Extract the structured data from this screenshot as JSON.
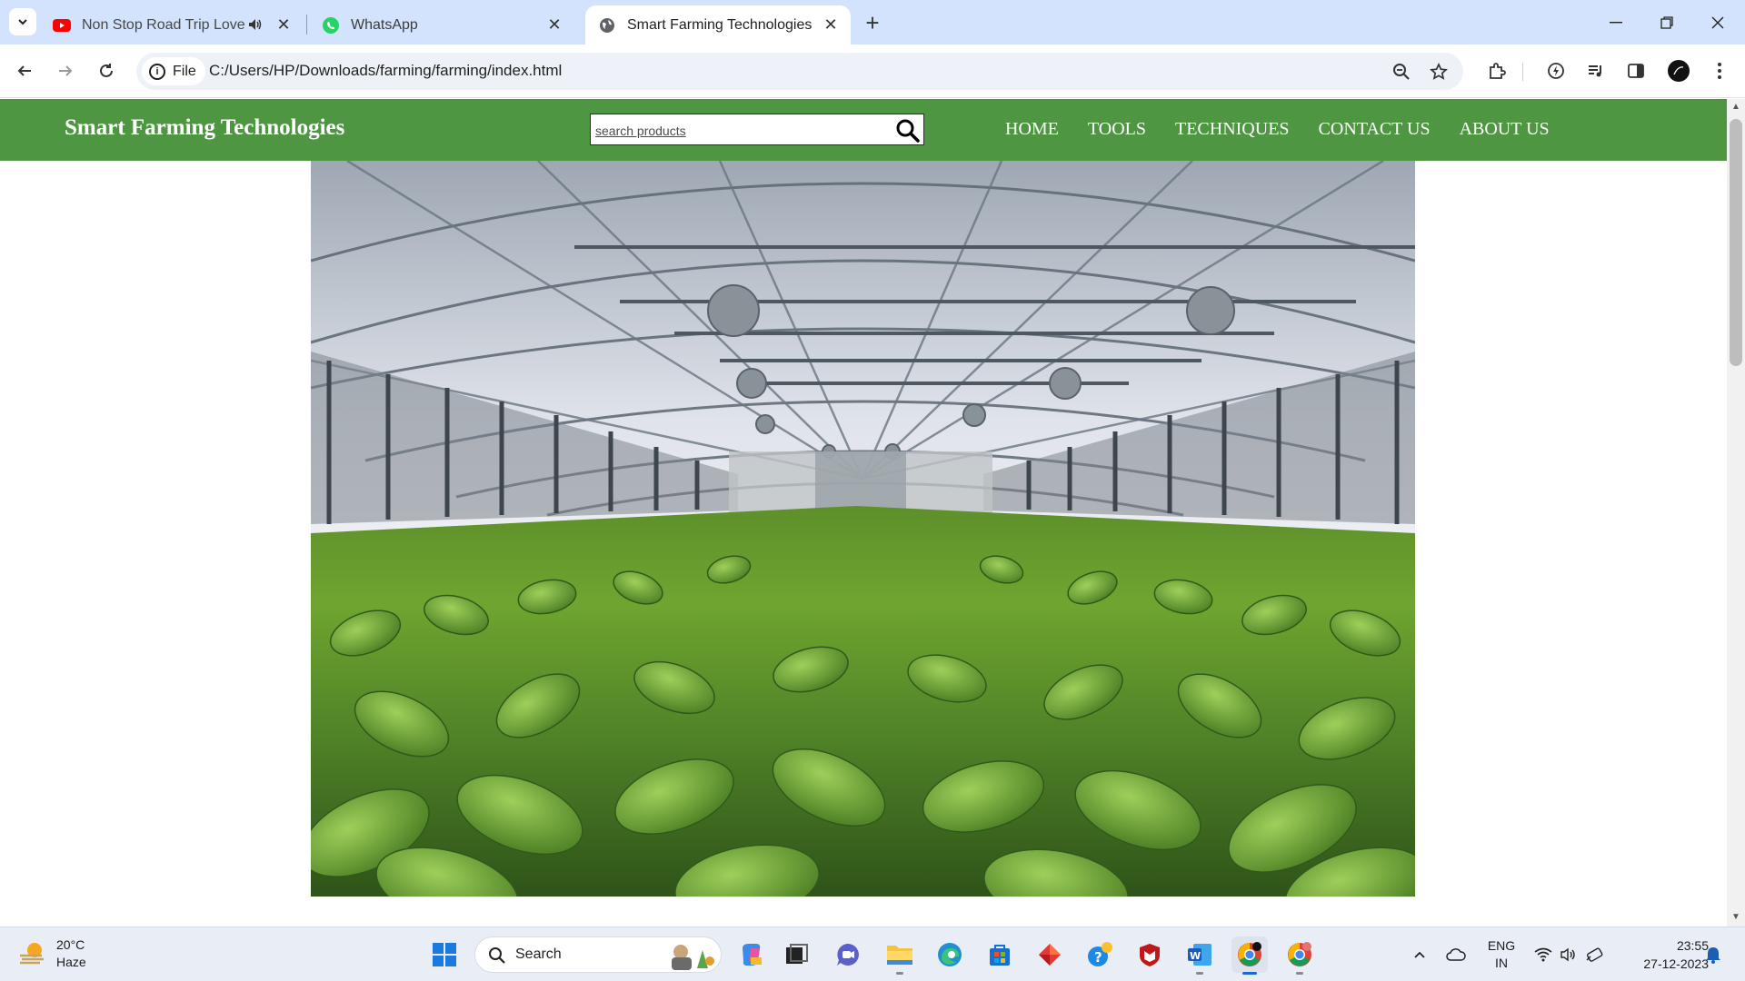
{
  "browser": {
    "tabs": [
      {
        "title": "Non Stop Road Trip Love Hindi Mashup",
        "icon": "youtube-icon",
        "audio_icon": "speaker-icon"
      },
      {
        "title": "WhatsApp",
        "icon": "whatsapp-icon"
      },
      {
        "title": "Smart Farming Technologies",
        "icon": "globe-icon",
        "active": true
      }
    ],
    "new_tab_label": "+",
    "address": {
      "scheme_chip": "File",
      "url": "C:/Users/HP/Downloads/farming/farming/index.html"
    }
  },
  "page": {
    "brand": "Smart Farming Technologies",
    "search": {
      "placeholder": "search products",
      "value": ""
    },
    "nav": [
      {
        "label": "HOME"
      },
      {
        "label": "TOOLS"
      },
      {
        "label": "TECHNIQUES"
      },
      {
        "label": "CONTACT US"
      },
      {
        "label": "ABOUT US"
      }
    ],
    "hero_image": "greenhouse-crops-photo"
  },
  "taskbar": {
    "weather": {
      "temp": "20°C",
      "condition": "Haze"
    },
    "search_label": "Search",
    "tray": {
      "lang_line1": "ENG",
      "lang_line2": "IN"
    },
    "clock": {
      "time": "23:55",
      "date": "27-12-2023"
    }
  },
  "colors": {
    "navbar_green": "#4f9643",
    "tab_strip": "#d3e3fd",
    "taskbar": "#e9eef6"
  }
}
